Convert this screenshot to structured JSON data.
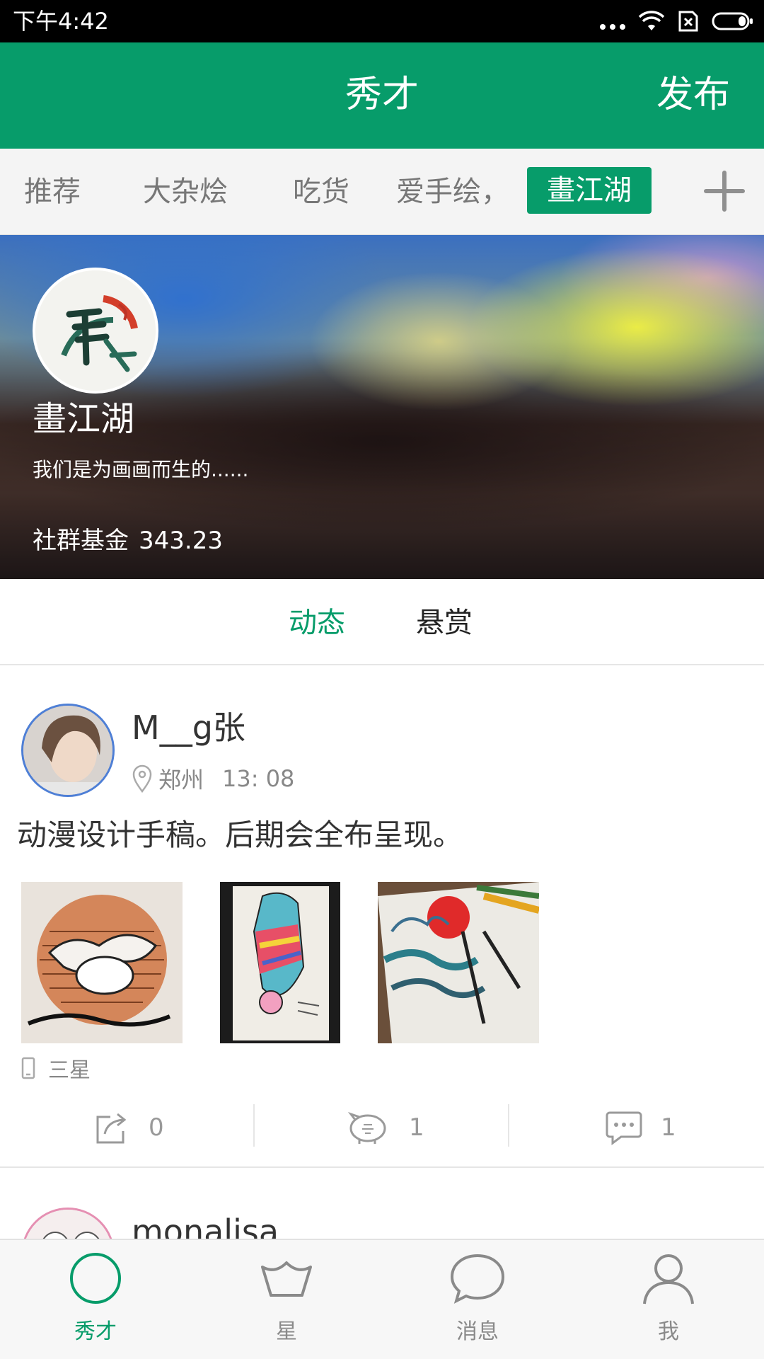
{
  "status_bar": {
    "time": "下午4:42"
  },
  "app_bar": {
    "title": "秀才",
    "publish_label": "发布"
  },
  "categories": {
    "items": [
      {
        "label": "推荐"
      },
      {
        "label": "大杂烩"
      },
      {
        "label": "吃货"
      },
      {
        "label": "爱手绘，"
      },
      {
        "label": "畫江湖",
        "active": true
      }
    ]
  },
  "group": {
    "name": "畫江湖",
    "description": "我们是为画画而生的......",
    "fund_label": "社群基金",
    "fund_value": "343.23"
  },
  "sub_tabs": {
    "items": [
      {
        "label": "动态",
        "active": true
      },
      {
        "label": "悬赏"
      }
    ]
  },
  "posts": [
    {
      "user": "M__g张",
      "location": "郑州",
      "time": "13: 08",
      "text": "动漫设计手稿。后期会全布呈现。",
      "device": "三星",
      "shares": "0",
      "rewards": "1",
      "comments": "1"
    },
    {
      "user": "monalisa"
    }
  ],
  "bottom_nav": {
    "items": [
      {
        "label": "秀才",
        "active": true
      },
      {
        "label": "星"
      },
      {
        "label": "消息"
      },
      {
        "label": "我"
      }
    ]
  },
  "colors": {
    "brand": "#079c6a",
    "avatar_ring": "#4e7fd6"
  }
}
